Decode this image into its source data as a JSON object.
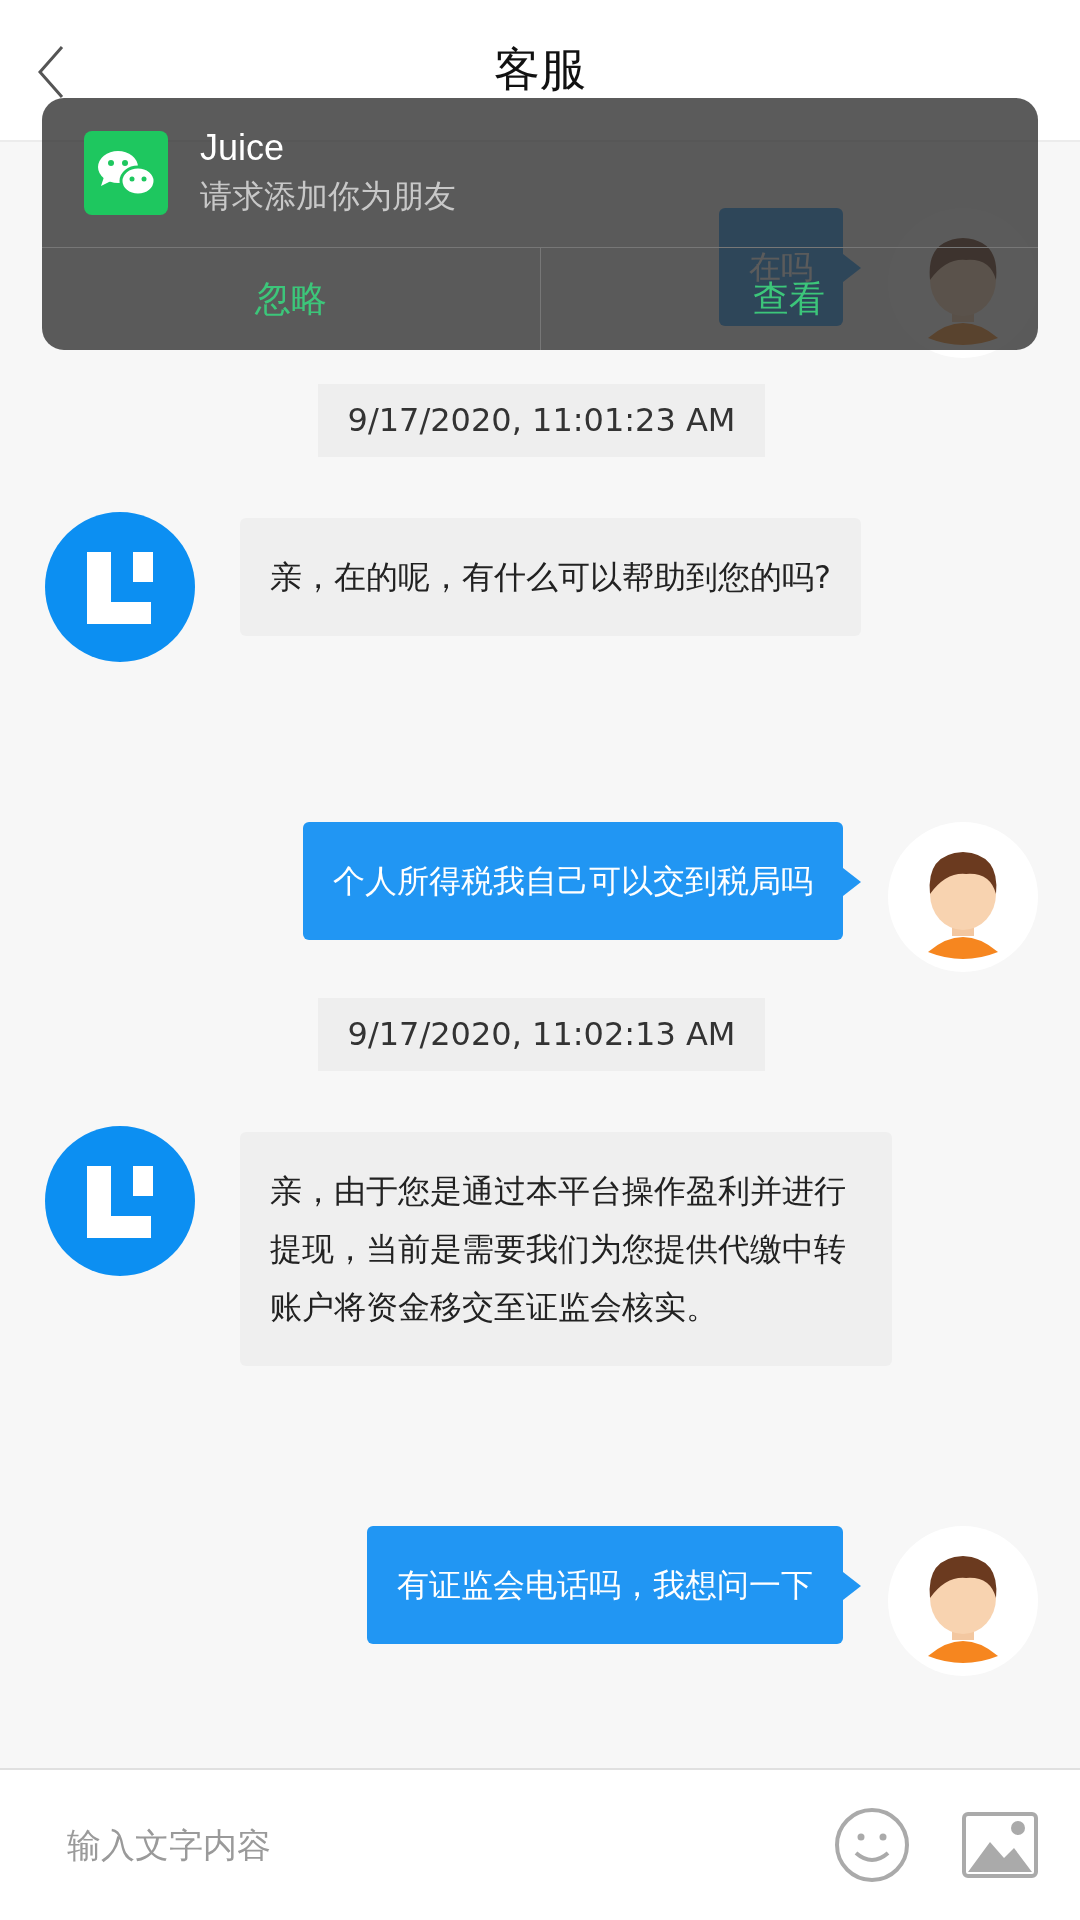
{
  "header": {
    "title": "客服"
  },
  "messages": [
    {
      "kind": "out",
      "text": "在吗"
    },
    {
      "kind": "time",
      "text": "9/17/2020, 11:01:23 AM"
    },
    {
      "kind": "in",
      "text": "亲，在的呢，有什么可以帮助到您的吗?"
    },
    {
      "kind": "out",
      "text": "个人所得税我自己可以交到税局吗"
    },
    {
      "kind": "time",
      "text": "9/17/2020, 11:02:13 AM"
    },
    {
      "kind": "in",
      "text": "亲，由于您是通过本平台操作盈利并进行提现，当前是需要我们为您提供代缴中转账户将资金移交至证监会核实。"
    },
    {
      "kind": "out",
      "text": "有证监会电话吗，我想问一下"
    }
  ],
  "notification": {
    "name": "Juice",
    "message": "请求添加你为朋友",
    "actions": [
      "忽略",
      "查看"
    ]
  },
  "input": {
    "placeholder": "输入文字内容"
  }
}
